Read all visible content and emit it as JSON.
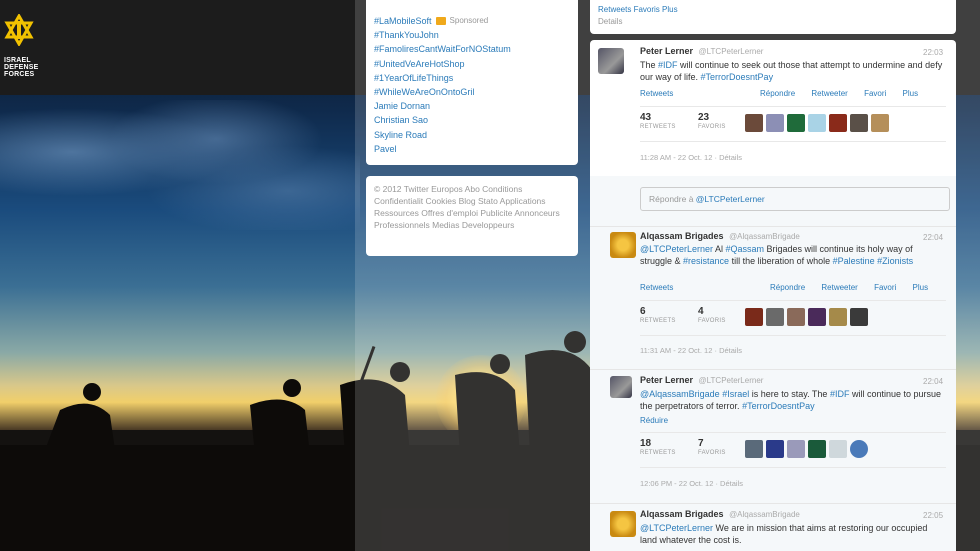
{
  "logo": {
    "text_line1": "ISRAEL",
    "text_line2": "DEFENSE",
    "text_line3": "FORCES"
  },
  "trends": {
    "items": [
      "#LaMobileSoft",
      "#ThankYouJohn",
      "#FamoliresCantWaitForNOStatum",
      "#UnitedVeAreHotShop",
      "#1YearOfLifeThings",
      "#WhileWeAreOnOntoGril",
      "Jamie Dornan",
      "Christian Sao",
      "Skyline Road",
      "Pavel"
    ],
    "promoted_label": "Sponsored"
  },
  "footer": {
    "text": "© 2012 Twitter  Europos  Abo  Conditions  Confidentialit  Cookies  Blog  Stato  Applications  Ressources  Offres d'emploi  Publicite  Annonceurs  Professionnels  Medias  Developpeurs"
  },
  "top_card": {
    "line1": "Retweets  Favoris  Plus",
    "line2": "Details"
  },
  "tweets": [
    {
      "name": "Peter Lerner",
      "handle": "@LTCPeterLerner",
      "time": "22:03",
      "text_parts": [
        {
          "t": "The ",
          "link": false
        },
        {
          "t": "#IDF",
          "link": true
        },
        {
          "t": " will continue to seek out those that attempt to undermine and defy our way of life. ",
          "link": false
        },
        {
          "t": "#TerrorDoesntPay",
          "link": true
        }
      ],
      "actions": [
        "Répondre",
        "Retweeter",
        "Favori",
        "Plus"
      ],
      "left_action": "Retweets",
      "stat1_num": "43",
      "stat1_lbl": "RETWEETS",
      "stat2_num": "23",
      "stat2_lbl": "FAVORIS",
      "meta": "11:28 AM - 22 Oct. 12  ·  Détails"
    },
    {
      "name": "Alqassam Brigades",
      "handle": "@AlqassamBrigade",
      "time": "22:04",
      "text_parts": [
        {
          "t": "@LTCPeterLerner",
          "link": true
        },
        {
          "t": " Al ",
          "link": false
        },
        {
          "t": "#Qassam",
          "link": true
        },
        {
          "t": " Brigades will continue its holy way of struggle & ",
          "link": false
        },
        {
          "t": "#resistance",
          "link": true
        },
        {
          "t": " till the liberation of whole ",
          "link": false
        },
        {
          "t": "#Palestine",
          "link": true
        },
        {
          "t": " ",
          "link": false
        },
        {
          "t": "#Zionists",
          "link": true
        }
      ],
      "actions": [
        "Répondre",
        "Retweeter",
        "Favori",
        "Plus"
      ],
      "left_action": "Retweets",
      "stat1_num": "6",
      "stat1_lbl": "RETWEETS",
      "stat2_num": "4",
      "stat2_lbl": "FAVORIS",
      "meta": "11:31 AM - 22 Oct. 12  ·  Détails"
    },
    {
      "name": "Peter Lerner",
      "handle": "@LTCPeterLerner",
      "time": "22:04",
      "text_parts": [
        {
          "t": "@AlqassamBrigade",
          "link": true
        },
        {
          "t": " ",
          "link": false
        },
        {
          "t": "#Israel",
          "link": true
        },
        {
          "t": " is here to stay. The ",
          "link": false
        },
        {
          "t": "#IDF",
          "link": true
        },
        {
          "t": " will continue to pursue the perpetrators of terror. ",
          "link": false
        },
        {
          "t": "#TerrorDoesntPay",
          "link": true
        }
      ],
      "actions": [],
      "left_action": "Réduire",
      "stat1_num": "18",
      "stat1_lbl": "RETWEETS",
      "stat2_num": "7",
      "stat2_lbl": "FAVORIS",
      "meta": "12:06 PM - 22 Oct. 12  ·  Détails"
    },
    {
      "name": "Alqassam Brigades",
      "handle": "@AlqassamBrigade",
      "time": "22:05",
      "text_parts": [
        {
          "t": "@LTCPeterLerner",
          "link": true
        },
        {
          "t": " We are in mission that aims at restoring our occupied land whatever the cost is.",
          "link": false
        }
      ]
    }
  ],
  "reply_box": {
    "prefix": "Répondre à ",
    "handle": "@LTCPeterLerner"
  },
  "colors": {
    "link": "#2b7bb9",
    "promo": "#f0a91b",
    "emblem": "#f2c200"
  }
}
